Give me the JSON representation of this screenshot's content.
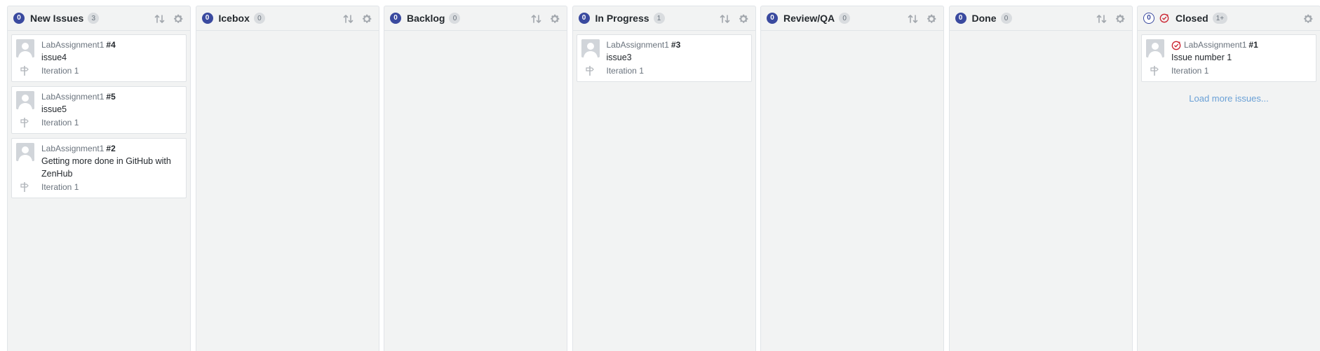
{
  "columns": [
    {
      "title": "New Issues",
      "points": "0",
      "count": "3",
      "points_style": "filled",
      "cards": [
        {
          "repo": "LabAssignment1",
          "number": "#4",
          "title": "issue4",
          "milestone": "Iteration 1"
        },
        {
          "repo": "LabAssignment1",
          "number": "#5",
          "title": "issue5",
          "milestone": "Iteration 1"
        },
        {
          "repo": "LabAssignment1",
          "number": "#2",
          "title": "Getting more done in GitHub with ZenHub",
          "milestone": "Iteration 1"
        }
      ]
    },
    {
      "title": "Icebox",
      "points": "0",
      "count": "0",
      "points_style": "filled",
      "cards": []
    },
    {
      "title": "Backlog",
      "points": "0",
      "count": "0",
      "points_style": "filled",
      "cards": []
    },
    {
      "title": "In Progress",
      "points": "0",
      "count": "1",
      "points_style": "filled",
      "cards": [
        {
          "repo": "LabAssignment1",
          "number": "#3",
          "title": "issue3",
          "milestone": "Iteration 1"
        }
      ]
    },
    {
      "title": "Review/QA",
      "points": "0",
      "count": "0",
      "points_style": "filled",
      "cards": []
    },
    {
      "title": "Done",
      "points": "0",
      "count": "0",
      "points_style": "filled",
      "cards": []
    },
    {
      "title": "Closed",
      "points": "0",
      "count": "1+",
      "points_style": "outline",
      "cards": [
        {
          "repo": "LabAssignment1",
          "number": "#1",
          "title": "Issue number 1",
          "milestone": "Iteration 1",
          "closed": true
        }
      ],
      "load_more": "Load more issues..."
    }
  ],
  "icons": {
    "sort": "sort-arrows-icon",
    "settings": "gear-icon",
    "milestone": "milestone-icon",
    "closed": "closed-issue-icon",
    "avatar": "avatar-placeholder"
  },
  "colors": {
    "points_badge": "#3a4a9f",
    "closed_icon": "#cb2431",
    "column_bg": "#f2f3f3",
    "link": "#6aa0d6"
  }
}
